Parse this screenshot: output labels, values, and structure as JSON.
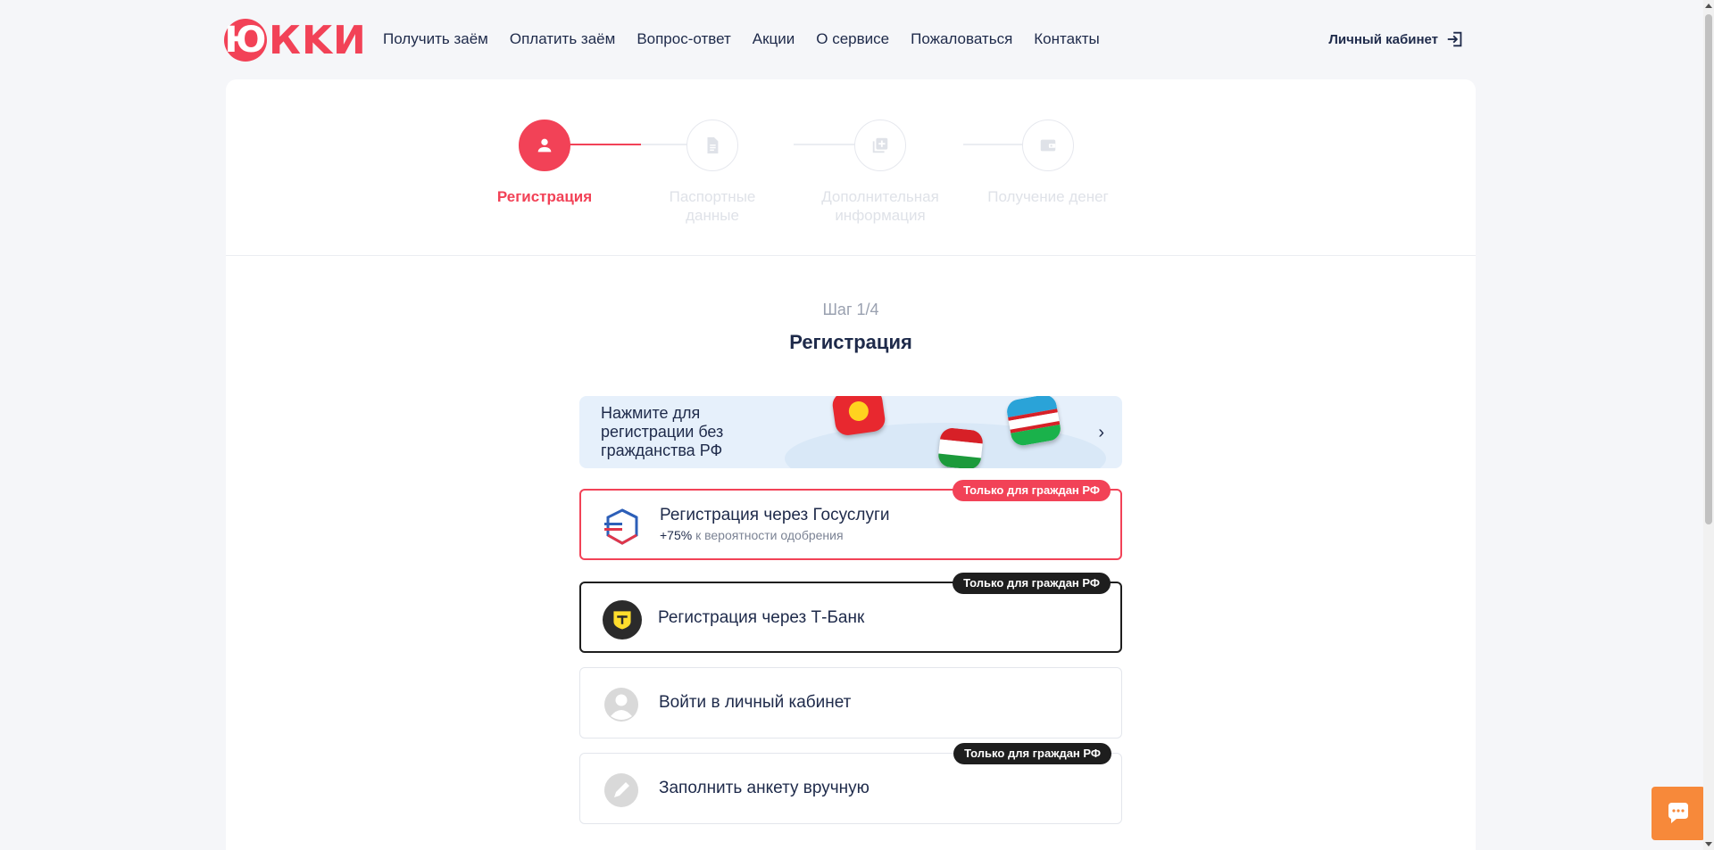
{
  "header": {
    "logo_letter": "Ю",
    "logo_rest": "КKИ",
    "nav": [
      "Получить заём",
      "Оплатить заём",
      "Вопрос-ответ",
      "Акции",
      "О сервисе",
      "Пожаловаться",
      "Контакты"
    ],
    "cabinet_label": "Личный кабинет"
  },
  "stepper": {
    "steps": [
      {
        "label": "Регистрация",
        "active": true,
        "icon": "user-icon"
      },
      {
        "label": "Паспортные данные",
        "active": false,
        "icon": "document-icon"
      },
      {
        "label": "Дополнительная информация",
        "active": false,
        "icon": "add-file-icon"
      },
      {
        "label": "Получение денег",
        "active": false,
        "icon": "wallet-icon"
      }
    ],
    "current_step": 1,
    "total_steps": 4
  },
  "main": {
    "step_counter": "Шаг 1/4",
    "title": "Регистрация",
    "banner_text": "Нажмите для регистрации без гражданства РФ",
    "options": [
      {
        "title": "Регистрация через Госуслуги",
        "sub_highlight": "+75%",
        "sub_text": " к вероятности одобрения",
        "badge": "Только для граждан РФ",
        "icon": "gosuslugi-icon"
      },
      {
        "title": "Регистрация через Т-Банк",
        "badge": "Только для граждан РФ",
        "icon": "tbank-icon"
      },
      {
        "title": "Войти в личный кабинет",
        "icon": "avatar-icon"
      },
      {
        "title": "Заполнить анкету вручную",
        "badge": "Только для граждан РФ",
        "icon": "pencil-icon"
      }
    ]
  },
  "colors": {
    "brand": "#f24257",
    "dark": "#1e2a4a",
    "chat": "#f7893a"
  }
}
